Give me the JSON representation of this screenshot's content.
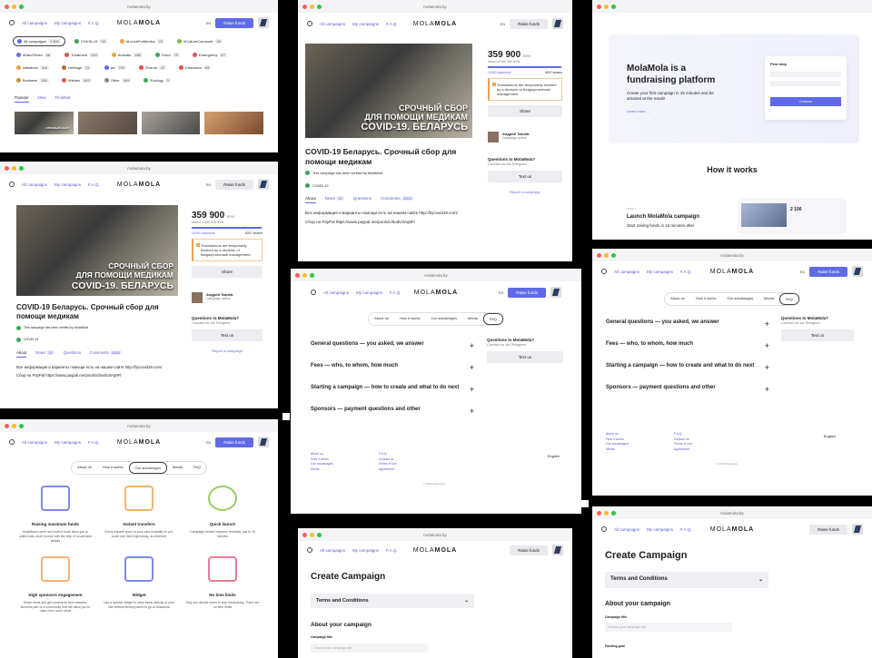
{
  "url": "molamola.by",
  "nav": {
    "links": [
      "All campaigns",
      "My campaigns",
      "F.A.Q."
    ],
    "logo_light": "MOLA",
    "logo_bold": "MOLA",
    "lang": "EN",
    "raise_funds": "Raise funds"
  },
  "home": {
    "chips": [
      {
        "label": "All campaigns",
        "count": "1 400",
        "color": "#5f6ae8"
      },
      {
        "label": "COVID-19",
        "count": "33",
        "color": "#3aa55d"
      },
      {
        "label": "#LunchForMedics",
        "count": "22",
        "color": "#f0a050"
      },
      {
        "label": "#CultureCommute",
        "count": "29",
        "color": "#7bbf3f"
      },
      {
        "label": "#HardTimes",
        "count": "48",
        "color": "#6b6bf0"
      },
      {
        "label": "Treatment",
        "count": "130",
        "color": "#e0564a"
      },
      {
        "label": "Animals",
        "count": "156",
        "color": "#e8a43b"
      },
      {
        "label": "Good",
        "count": "79",
        "color": "#3aa55d"
      },
      {
        "label": "Emergency",
        "count": "47",
        "color": "#e05050"
      },
      {
        "label": "Initiatives",
        "count": "116",
        "color": "#e8a43b"
      },
      {
        "label": "Heritage",
        "count": "21",
        "color": "#b56c3a"
      },
      {
        "label": "Art",
        "count": "731",
        "color": "#5f6ae8"
      },
      {
        "label": "Events",
        "count": "22",
        "color": "#e05050"
      },
      {
        "label": "Education",
        "count": "63",
        "color": "#e05050"
      },
      {
        "label": "Business",
        "count": "150",
        "color": "#c0953a"
      },
      {
        "label": "Wishes",
        "count": "262",
        "color": "#e0564a"
      },
      {
        "label": "Other",
        "count": "409",
        "color": "#888"
      },
      {
        "label": "Ecology",
        "count": "3",
        "color": "#3aa55d"
      }
    ],
    "tabs": [
      "Popular",
      "New",
      "Finished"
    ],
    "thumb_caption": "СРОЧНЫЙ СБОР"
  },
  "campaign": {
    "hero_line1": "СРОЧНЫЙ СБОР",
    "hero_line2": "ДЛЯ ПОМОЩИ МЕДИКАМ",
    "hero_line3": "COVID-19. БЕЛАРУСЬ",
    "amount": "359 900",
    "currency": "BYN",
    "raised_of": "raised of 360 000 BYN",
    "progress": 0.99,
    "payments": "10393 payments",
    "shares": "4007 shares",
    "notice": "Transactions are temporarily blocked by a decision of Belgazprombank management.",
    "share": "Share",
    "title": "COVID-19 Беларусь. Срочный сбор для помощи медикам",
    "verified": "This campaign has been verified by MolaMola",
    "tag": "COVID-19",
    "author_name": "Андрей Ткачёв",
    "author_note": "Campaign author",
    "tabs": [
      {
        "label": "About"
      },
      {
        "label": "News",
        "count": "19"
      },
      {
        "label": "Questions"
      },
      {
        "label": "Comments",
        "count": "2004"
      }
    ],
    "desc": "Все информация и варианты помощи есть на нашем сайте http://bycovid19.com/",
    "paypal": "Сбор на PayPal https://www.paypal.me/pools/c/8odU3Aq9Fl",
    "questions_title": "Questions to MolaMola?",
    "questions_sub": "Contact us via Telegram",
    "text_us": "Text us",
    "report": "Report a campaign"
  },
  "landing": {
    "headline": "MolaMola is a fundraising platform",
    "sub": "Create your first campaign in 15 minutes and be amazed at the result!",
    "learn": "Learn more →",
    "step": "First step",
    "how": "How it works",
    "step1": "STEP 1",
    "step1_title": "Launch MolaMola campaign",
    "step1_sub": "Start raising funds in 15 minutes after",
    "continue": "Continue"
  },
  "faq": {
    "tabs": [
      "About us",
      "How it works",
      "Our advantages",
      "Media",
      "FAQ"
    ],
    "items": [
      "General questions — you asked, we answer",
      "Fees — who, to whom, how much",
      "Starting a campaign — how to create and what to do next",
      "Sponsors — payment questions and other"
    ],
    "footer_col1": [
      "About us",
      "How it works",
      "Our advantages",
      "Media"
    ],
    "footer_col2": [
      "F.A.Q.",
      "Contact us",
      "Terms of use",
      "Agreement"
    ],
    "lang": "English",
    "copyright": "© 2020 Molamola"
  },
  "advantages": {
    "items": [
      {
        "title": "Raising maximum funds",
        "text": "MolaMola's open and built-in tools allow you to collect way more money with the help of usual bank details"
      },
      {
        "title": "Instant transfers",
        "text": "Every transfer goes to your card instantly so you could use them right away, as intended"
      },
      {
        "title": "Quick launch",
        "text": "Campaign launch happens remotely, just in 15 minutes"
      },
      {
        "title": "High sponsors engagement",
        "text": "Share news and get comments from backers. Become part of a community that will allow you to raise even more funds"
      },
      {
        "title": "Widget",
        "text": "Use a special widget to raise funds directly at your site without limiting users to go to MolaMola"
      },
      {
        "title": "No time limits",
        "text": "Only you decide when to stop fundraising. There are no time limits"
      }
    ]
  },
  "create": {
    "title": "Create Campaign",
    "terms": "Terms and Conditions",
    "about": "About your campaign",
    "campaign_title": "Campaign title",
    "title_placeholder": "Choose your campaign title",
    "funding_goal": "Funding goal"
  }
}
